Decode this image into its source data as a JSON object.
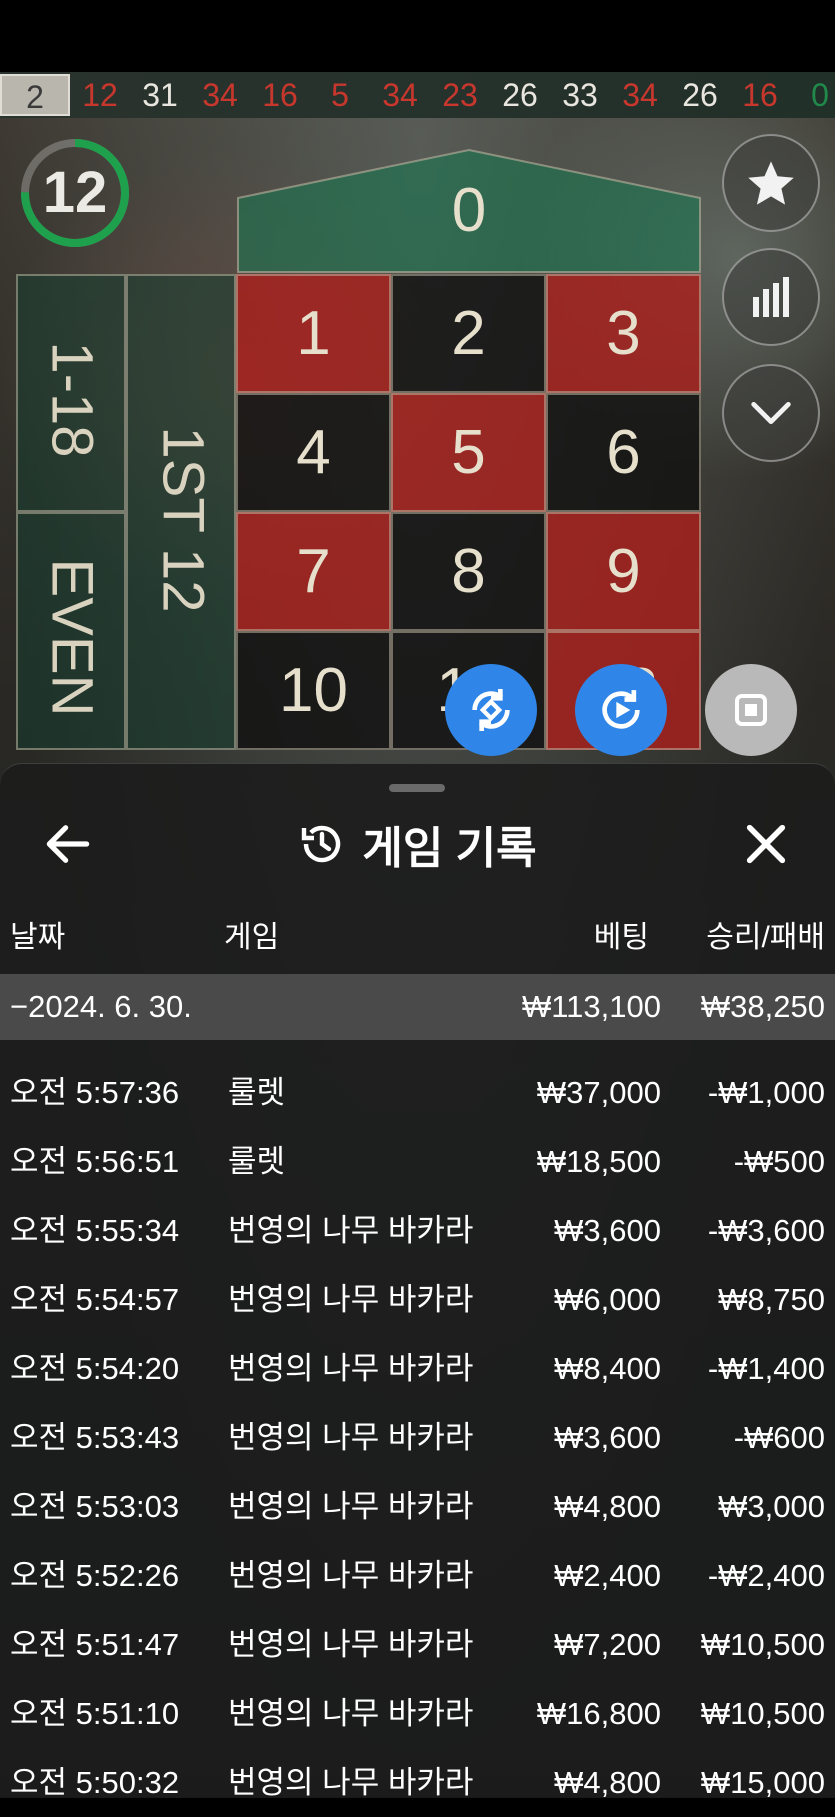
{
  "history": {
    "numbers": [
      {
        "n": "2",
        "color": "current"
      },
      {
        "n": "12",
        "color": "red"
      },
      {
        "n": "31",
        "color": "black"
      },
      {
        "n": "34",
        "color": "red"
      },
      {
        "n": "16",
        "color": "red"
      },
      {
        "n": "5",
        "color": "red"
      },
      {
        "n": "34",
        "color": "red"
      },
      {
        "n": "23",
        "color": "red"
      },
      {
        "n": "26",
        "color": "black"
      },
      {
        "n": "33",
        "color": "black"
      },
      {
        "n": "34",
        "color": "red"
      },
      {
        "n": "26",
        "color": "black"
      },
      {
        "n": "16",
        "color": "red"
      },
      {
        "n": "0",
        "color": "green"
      }
    ]
  },
  "timer": {
    "value": "12"
  },
  "board": {
    "zero": "0",
    "numbers": [
      {
        "n": "1",
        "color": "red"
      },
      {
        "n": "2",
        "color": "black"
      },
      {
        "n": "3",
        "color": "red"
      },
      {
        "n": "4",
        "color": "black"
      },
      {
        "n": "5",
        "color": "red"
      },
      {
        "n": "6",
        "color": "black"
      },
      {
        "n": "7",
        "color": "red"
      },
      {
        "n": "8",
        "color": "black"
      },
      {
        "n": "9",
        "color": "red"
      },
      {
        "n": "10",
        "color": "black"
      },
      {
        "n": "11",
        "color": "black"
      },
      {
        "n": "12",
        "color": "red"
      }
    ],
    "bet_1_18": "1-18",
    "bet_even": "EVEN",
    "bet_first12": "1ST 12"
  },
  "panel": {
    "title": "게임 기록",
    "columns": {
      "date": "날짜",
      "game": "게임",
      "bet": "베팅",
      "result": "승리/패배"
    },
    "summary": {
      "date": "−2024. 6. 30.",
      "bet": "₩113,100",
      "result": "₩38,250"
    },
    "rows": [
      {
        "time": "오전 5:57:36",
        "game": "룰렛",
        "bet": "₩37,000",
        "result": "-₩1,000"
      },
      {
        "time": "오전 5:56:51",
        "game": "룰렛",
        "bet": "₩18,500",
        "result": "-₩500"
      },
      {
        "time": "오전 5:55:34",
        "game": "번영의 나무 바카라",
        "bet": "₩3,600",
        "result": "-₩3,600"
      },
      {
        "time": "오전 5:54:57",
        "game": "번영의 나무 바카라",
        "bet": "₩6,000",
        "result": "₩8,750"
      },
      {
        "time": "오전 5:54:20",
        "game": "번영의 나무 바카라",
        "bet": "₩8,400",
        "result": "-₩1,400"
      },
      {
        "time": "오전 5:53:43",
        "game": "번영의 나무 바카라",
        "bet": "₩3,600",
        "result": "-₩600"
      },
      {
        "time": "오전 5:53:03",
        "game": "번영의 나무 바카라",
        "bet": "₩4,800",
        "result": "₩3,000"
      },
      {
        "time": "오전 5:52:26",
        "game": "번영의 나무 바카라",
        "bet": "₩2,400",
        "result": "-₩2,400"
      },
      {
        "time": "오전 5:51:47",
        "game": "번영의 나무 바카라",
        "bet": "₩7,200",
        "result": "₩10,500"
      },
      {
        "time": "오전 5:51:10",
        "game": "번영의 나무 바카라",
        "bet": "₩16,800",
        "result": "₩10,500"
      },
      {
        "time": "오전 5:50:32",
        "game": "번영의 나무 바카라",
        "bet": "₩4,800",
        "result": "₩15,000"
      }
    ]
  },
  "colors": {
    "accent_blue": "#2f86e8",
    "timer_green": "#1fa04d",
    "red": "#c8372d"
  }
}
